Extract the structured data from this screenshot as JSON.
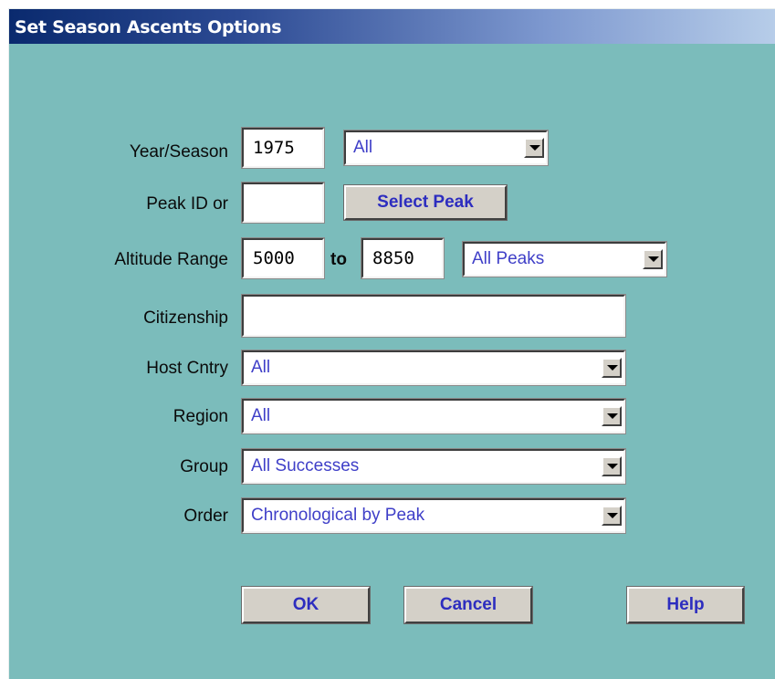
{
  "window": {
    "title": "Set Season Ascents Options"
  },
  "form": {
    "year_season": {
      "label": "Year/Season",
      "year": "1975",
      "season": "All"
    },
    "peak": {
      "label": "Peak ID or",
      "value": "",
      "button": "Select Peak"
    },
    "altitude": {
      "label": "Altitude Range",
      "from": "5000",
      "to_label": "to",
      "to": "8850",
      "filter": "All Peaks"
    },
    "citizenship": {
      "label": "Citizenship",
      "value": ""
    },
    "host_cntry": {
      "label": "Host Cntry",
      "value": "All"
    },
    "region": {
      "label": "Region",
      "value": "All"
    },
    "group": {
      "label": "Group",
      "value": "All Successes"
    },
    "order": {
      "label": "Order",
      "value": "Chronological by Peak"
    }
  },
  "buttons": {
    "ok": "OK",
    "cancel": "Cancel",
    "help": "Help"
  },
  "colors": {
    "background": "#7bbcbb",
    "title_gradient_start": "#0a2a6e",
    "title_gradient_end": "#b7cde9",
    "value_text": "#3f3fc8",
    "button_text": "#2d2dbf"
  },
  "icons": {
    "dropdown": "chevron-down-icon"
  }
}
